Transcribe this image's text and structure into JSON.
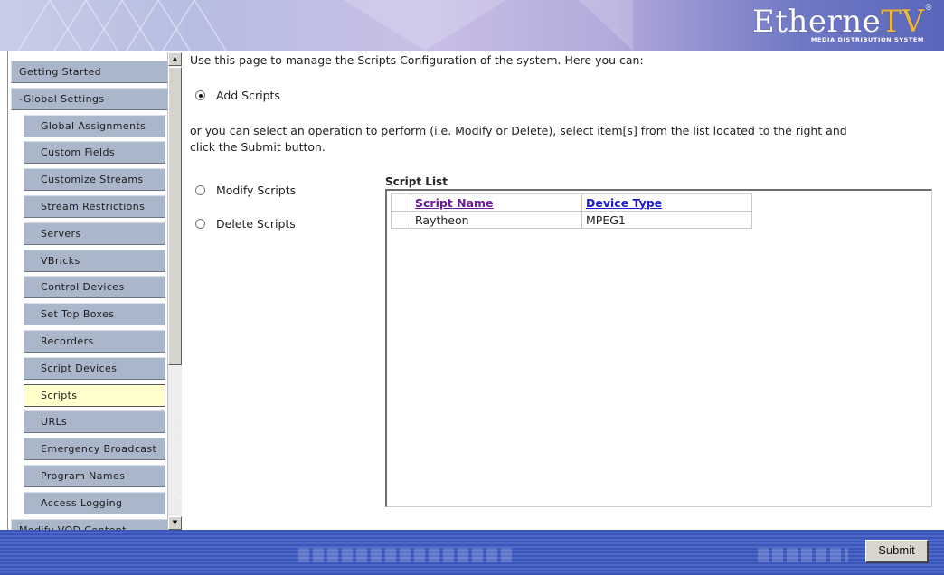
{
  "brand": {
    "name_part1": "Etherne",
    "name_part2": "TV",
    "reg": "®",
    "tagline": "MEDIA DISTRIBUTION SYSTEM"
  },
  "sidebar": {
    "items": [
      {
        "label": "Getting Started",
        "level": "top"
      },
      {
        "label": "-Global Settings",
        "level": "top"
      },
      {
        "label": "Global Assignments",
        "level": "sub"
      },
      {
        "label": "Custom Fields",
        "level": "sub"
      },
      {
        "label": "Customize Streams",
        "level": "sub"
      },
      {
        "label": "Stream Restrictions",
        "level": "sub"
      },
      {
        "label": "Servers",
        "level": "sub"
      },
      {
        "label": "VBricks",
        "level": "sub"
      },
      {
        "label": "Control Devices",
        "level": "sub"
      },
      {
        "label": "Set Top Boxes",
        "level": "sub"
      },
      {
        "label": "Recorders",
        "level": "sub"
      },
      {
        "label": "Script Devices",
        "level": "sub"
      },
      {
        "label": "Scripts",
        "level": "sub",
        "active": true
      },
      {
        "label": "URLs",
        "level": "sub"
      },
      {
        "label": "Emergency Broadcast",
        "level": "sub"
      },
      {
        "label": "Program Names",
        "level": "sub"
      },
      {
        "label": "Access Logging",
        "level": "sub"
      },
      {
        "label": "Modify VOD Content",
        "level": "top"
      }
    ]
  },
  "main": {
    "intro": "Use this page to manage the Scripts Configuration of the system. Here you can:",
    "add_label": "Add Scripts",
    "instructions_line1": "or you can select an operation to perform (i.e. Modify or Delete), select item[s] from the list located to the right and",
    "instructions_line2": "click the Submit button.",
    "modify_label": "Modify Scripts",
    "delete_label": "Delete Scripts",
    "list_title": "Script List",
    "columns": [
      "Script Name",
      "Device Type"
    ],
    "rows": [
      {
        "name": "Raytheon",
        "type": "MPEG1"
      }
    ]
  },
  "footer": {
    "submit_label": "Submit"
  }
}
